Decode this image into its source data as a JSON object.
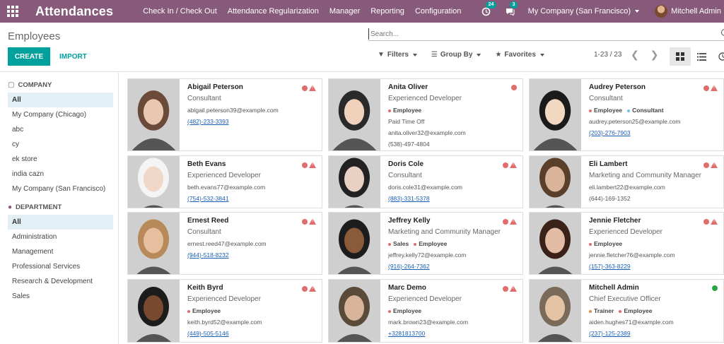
{
  "navbar": {
    "app_title": "Attendances",
    "menu": [
      "Check In / Check Out",
      "Attendance Regularization",
      "Manager",
      "Reporting",
      "Configuration"
    ],
    "activity_count": "24",
    "messages_count": "3",
    "company": "My Company (San Francisco)",
    "user": "Mitchell Admin",
    "accent": "#875a7b"
  },
  "control_panel": {
    "breadcrumb": "Employees",
    "search_placeholder": "Search...",
    "create_label": "CREATE",
    "import_label": "IMPORT",
    "filters_label": "Filters",
    "groupby_label": "Group By",
    "favorites_label": "Favorites",
    "pager": "1-23 / 23",
    "brand_color": "#00a09d"
  },
  "sidebar": {
    "company_header": "COMPANY",
    "companies": [
      "All",
      "My Company (Chicago)",
      "abc",
      "cy",
      "ek store",
      "india cazn",
      "My Company (San Francisco)"
    ],
    "department_header": "DEPARTMENT",
    "departments": [
      "All",
      "Administration",
      "Management",
      "Professional Services",
      "Research & Development",
      "Sales"
    ]
  },
  "employees": [
    {
      "name": "Abigail Peterson",
      "job": "Consultant",
      "tags": [],
      "work_location": "",
      "email": "abigail.peterson39@example.com",
      "phone": "(482)-233-3393",
      "phone_link": true,
      "status": "warn"
    },
    {
      "name": "Anita Oliver",
      "job": "Experienced Developer",
      "tags": [
        {
          "label": "Employee",
          "color": "#e06c6c"
        }
      ],
      "work_location": "Paid Time Off",
      "email": "anita.oliver32@example.com",
      "phone": "(538)-497-4804",
      "phone_link": false,
      "status": "red"
    },
    {
      "name": "Audrey Peterson",
      "job": "Consultant",
      "tags": [
        {
          "label": "Employee",
          "color": "#e06c6c"
        },
        {
          "label": "Consultant",
          "color": "#6cc1ed"
        }
      ],
      "work_location": "",
      "email": "audrey.peterson25@example.com",
      "phone": "(203)-276-7903",
      "phone_link": true,
      "status": "warn"
    },
    {
      "name": "Beth Evans",
      "job": "Experienced Developer",
      "tags": [],
      "work_location": "",
      "email": "beth.evans77@example.com",
      "phone": "(754)-532-3841",
      "phone_link": true,
      "status": "warn"
    },
    {
      "name": "Doris Cole",
      "job": "Consultant",
      "tags": [],
      "work_location": "",
      "email": "doris.cole31@example.com",
      "phone": "(883)-331-5378",
      "phone_link": true,
      "status": "warn"
    },
    {
      "name": "Eli Lambert",
      "job": "Marketing and Community Manager",
      "tags": [],
      "work_location": "",
      "email": "eli.lambert22@example.com",
      "phone": "(644)-169-1352",
      "phone_link": false,
      "status": "warn"
    },
    {
      "name": "Ernest Reed",
      "job": "Consultant",
      "tags": [],
      "work_location": "",
      "email": "ernest.reed47@example.com",
      "phone": "(944)-518-8232",
      "phone_link": true,
      "status": "warn"
    },
    {
      "name": "Jeffrey Kelly",
      "job": "Marketing and Community Manager",
      "tags": [
        {
          "label": "Sales",
          "color": "#e06c6c"
        },
        {
          "label": "Employee",
          "color": "#e06c6c"
        }
      ],
      "work_location": "",
      "email": "jeffrey.kelly72@example.com",
      "phone": "(916)-264-7362",
      "phone_link": true,
      "status": "warn"
    },
    {
      "name": "Jennie Fletcher",
      "job": "Experienced Developer",
      "tags": [
        {
          "label": "Employee",
          "color": "#e06c6c"
        }
      ],
      "work_location": "",
      "email": "jennie.fletcher76@example.com",
      "phone": "(157)-363-8229",
      "phone_link": true,
      "status": "warn"
    },
    {
      "name": "Keith Byrd",
      "job": "Experienced Developer",
      "tags": [
        {
          "label": "Employee",
          "color": "#e06c6c"
        }
      ],
      "work_location": "",
      "email": "keith.byrd52@example.com",
      "phone": "(449)-505-5146",
      "phone_link": true,
      "status": "warn"
    },
    {
      "name": "Marc Demo",
      "job": "Experienced Developer",
      "tags": [
        {
          "label": "Employee",
          "color": "#e06c6c"
        }
      ],
      "work_location": "",
      "email": "mark.brown23@example.com",
      "phone": "+3281813700",
      "phone_link": true,
      "status": "warn"
    },
    {
      "name": "Mitchell Admin",
      "job": "Chief Executive Officer",
      "tags": [
        {
          "label": "Trainer",
          "color": "#e08d4a"
        },
        {
          "label": "Employee",
          "color": "#e06c6c"
        }
      ],
      "work_location": "",
      "email": "aiden.hughes71@example.com",
      "phone": "(237)-125-2389",
      "phone_link": true,
      "status": "green"
    }
  ]
}
